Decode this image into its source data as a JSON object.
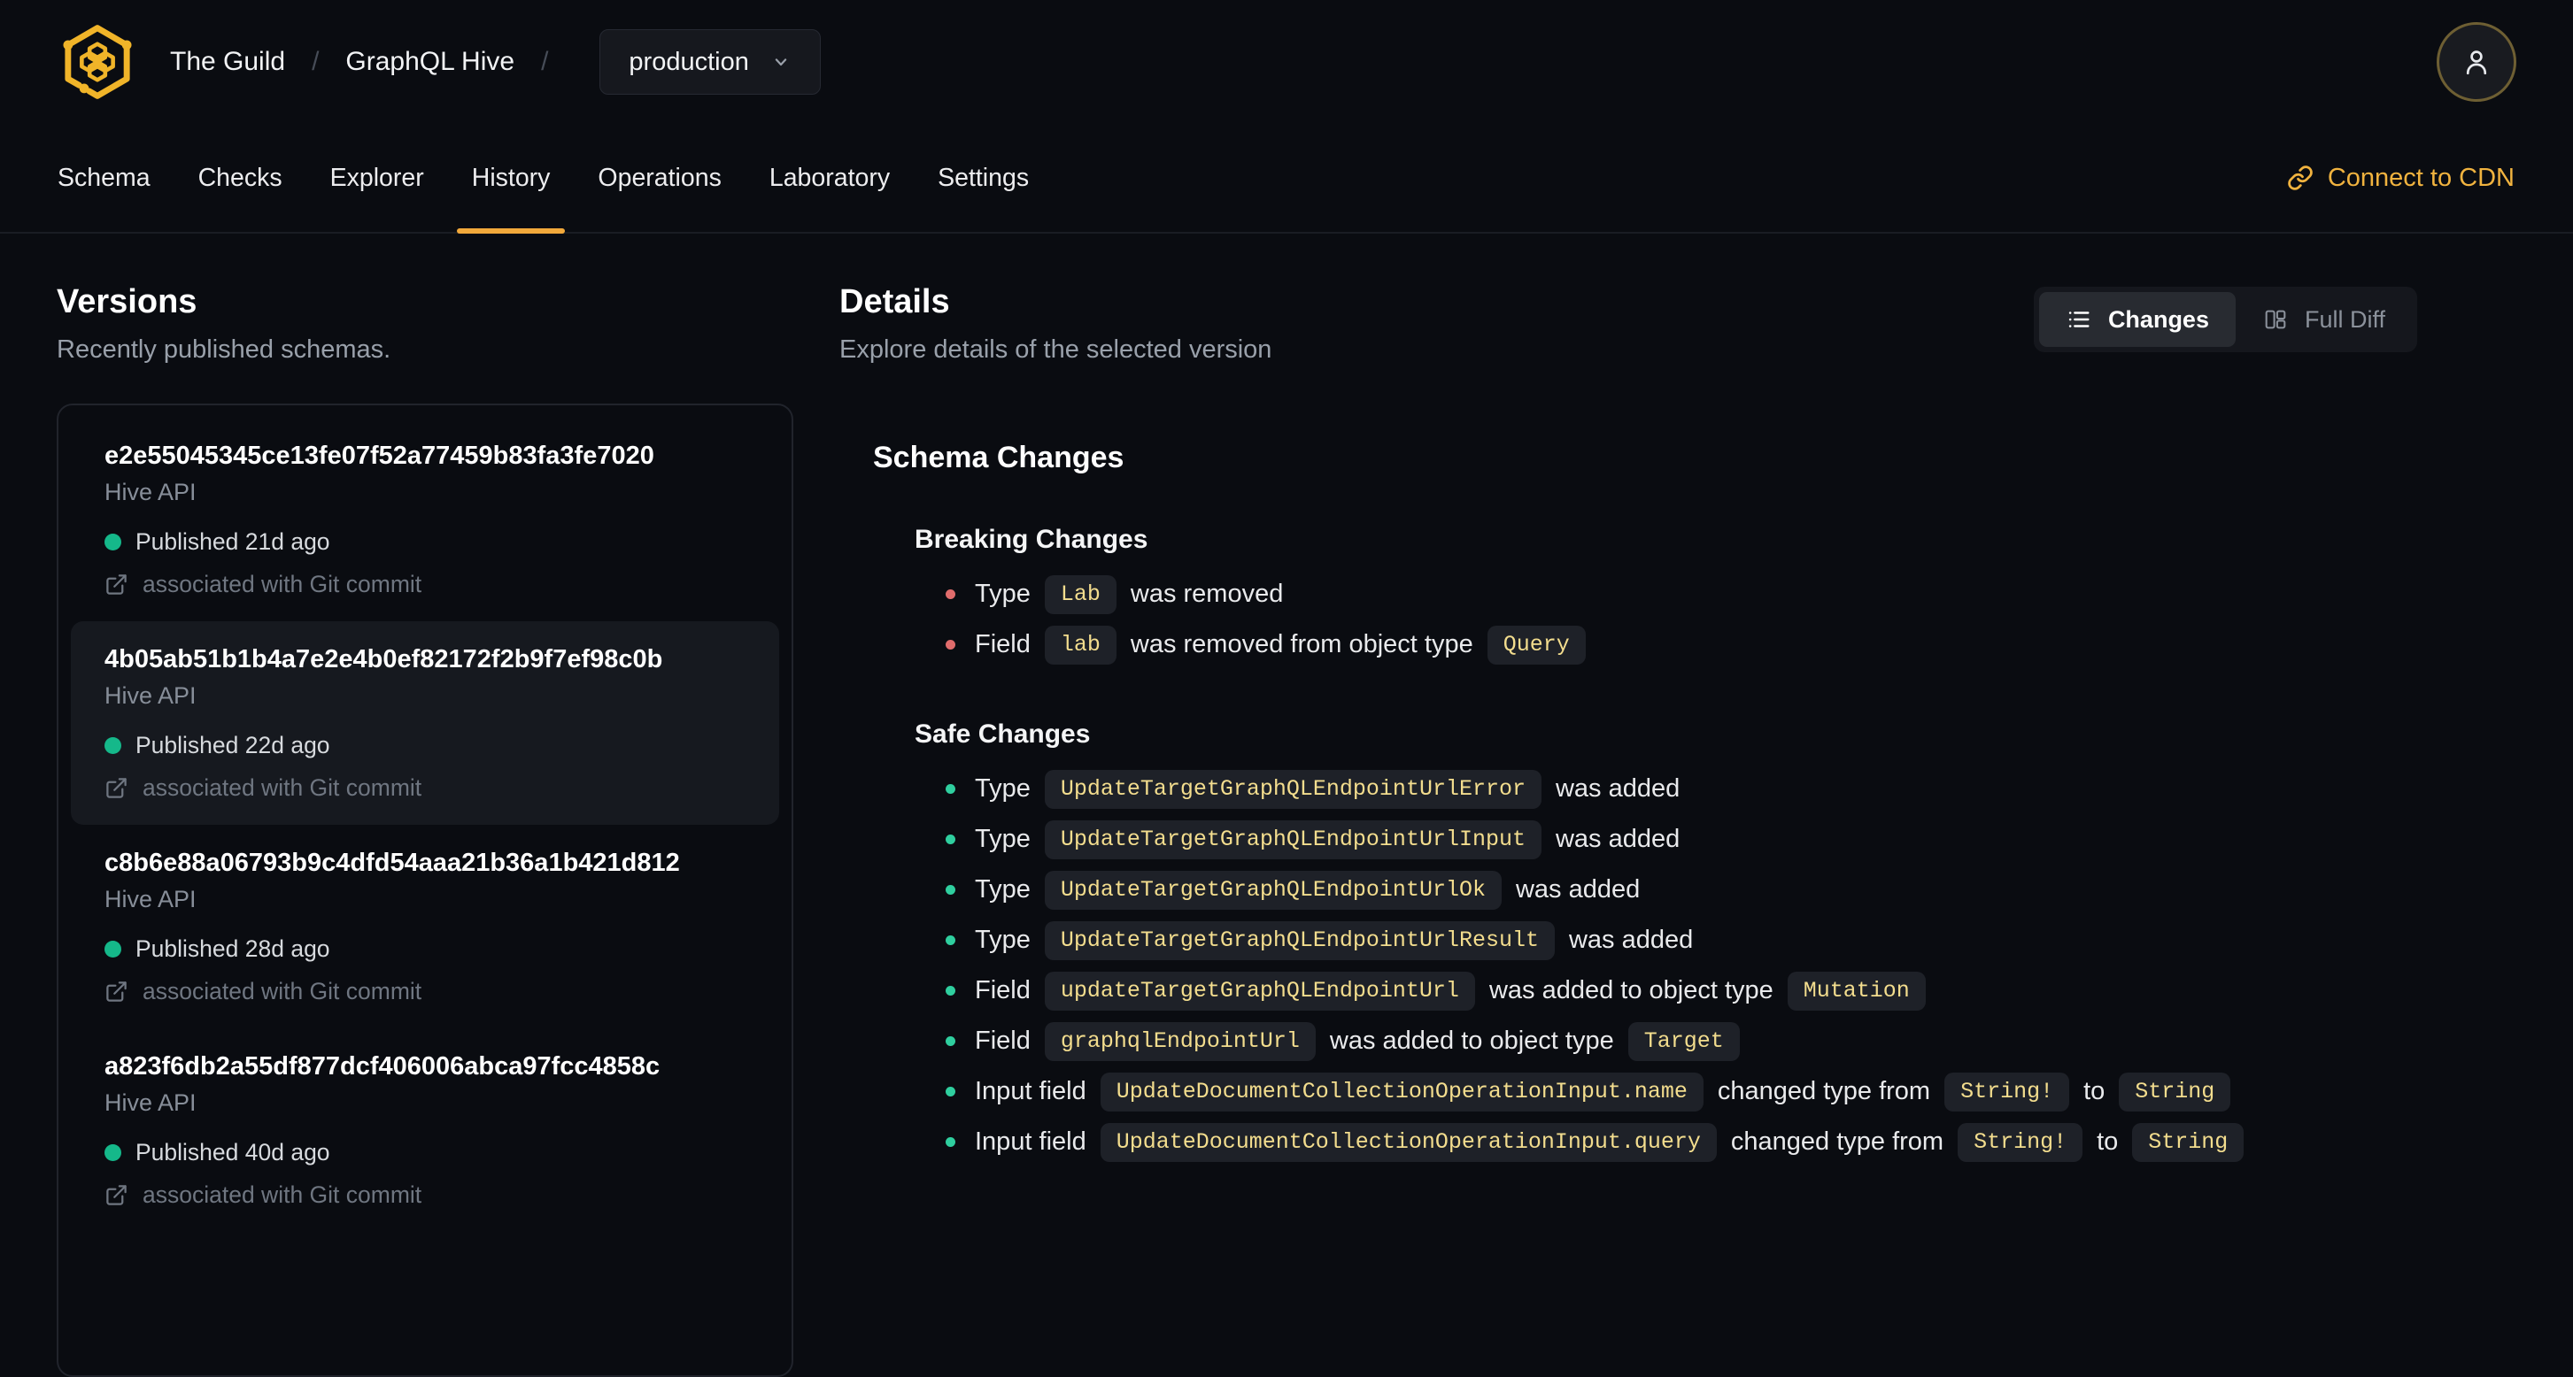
{
  "brand": {
    "org": "The Guild",
    "project": "GraphQL Hive",
    "environment": "production",
    "breadcrumb_separator": "/",
    "logo": "hive-honeycomb-icon"
  },
  "header": {
    "connect_cdn_label": "Connect to CDN",
    "avatar_icon": "user-icon"
  },
  "tabs": [
    {
      "label": "Schema",
      "active": false
    },
    {
      "label": "Checks",
      "active": false
    },
    {
      "label": "Explorer",
      "active": false
    },
    {
      "label": "History",
      "active": true
    },
    {
      "label": "Operations",
      "active": false
    },
    {
      "label": "Laboratory",
      "active": false
    },
    {
      "label": "Settings",
      "active": false
    }
  ],
  "versions": {
    "title": "Versions",
    "subtitle": "Recently published schemas.",
    "items": [
      {
        "hash": "e2e55045345ce13fe07f52a77459b83fa3fe7020",
        "service": "Hive API",
        "published": "Published 21d ago",
        "git": "associated with Git commit",
        "selected": false
      },
      {
        "hash": "4b05ab51b1b4a7e2e4b0ef82172f2b9f7ef98c0b",
        "service": "Hive API",
        "published": "Published 22d ago",
        "git": "associated with Git commit",
        "selected": true
      },
      {
        "hash": "c8b6e88a06793b9c4dfd54aaa21b36a1b421d812",
        "service": "Hive API",
        "published": "Published 28d ago",
        "git": "associated with Git commit",
        "selected": false
      },
      {
        "hash": "a823f6db2a55df877dcf406006abca97fcc4858c",
        "service": "Hive API",
        "published": "Published 40d ago",
        "git": "associated with Git commit",
        "selected": false
      }
    ]
  },
  "details": {
    "title": "Details",
    "subtitle": "Explore details of the selected version",
    "view_toggle": {
      "options": [
        {
          "label": "Changes",
          "icon": "list-icon",
          "active": true
        },
        {
          "label": "Full Diff",
          "icon": "columns-icon",
          "active": false
        }
      ]
    },
    "schema_changes": {
      "title": "Schema Changes",
      "groups": [
        {
          "title": "Breaking Changes",
          "severity": "breaking",
          "items": [
            [
              {
                "t": "text",
                "v": "Type"
              },
              {
                "t": "code",
                "v": "Lab"
              },
              {
                "t": "text",
                "v": "was removed"
              }
            ],
            [
              {
                "t": "text",
                "v": "Field"
              },
              {
                "t": "code",
                "v": "lab"
              },
              {
                "t": "text",
                "v": "was removed from object type"
              },
              {
                "t": "code",
                "v": "Query"
              }
            ]
          ]
        },
        {
          "title": "Safe Changes",
          "severity": "safe",
          "items": [
            [
              {
                "t": "text",
                "v": "Type"
              },
              {
                "t": "code",
                "v": "UpdateTargetGraphQLEndpointUrlError"
              },
              {
                "t": "text",
                "v": "was added"
              }
            ],
            [
              {
                "t": "text",
                "v": "Type"
              },
              {
                "t": "code",
                "v": "UpdateTargetGraphQLEndpointUrlInput"
              },
              {
                "t": "text",
                "v": "was added"
              }
            ],
            [
              {
                "t": "text",
                "v": "Type"
              },
              {
                "t": "code",
                "v": "UpdateTargetGraphQLEndpointUrlOk"
              },
              {
                "t": "text",
                "v": "was added"
              }
            ],
            [
              {
                "t": "text",
                "v": "Type"
              },
              {
                "t": "code",
                "v": "UpdateTargetGraphQLEndpointUrlResult"
              },
              {
                "t": "text",
                "v": "was added"
              }
            ],
            [
              {
                "t": "text",
                "v": "Field"
              },
              {
                "t": "code",
                "v": "updateTargetGraphQLEndpointUrl"
              },
              {
                "t": "text",
                "v": "was added to object type"
              },
              {
                "t": "code",
                "v": "Mutation"
              }
            ],
            [
              {
                "t": "text",
                "v": "Field"
              },
              {
                "t": "code",
                "v": "graphqlEndpointUrl"
              },
              {
                "t": "text",
                "v": "was added to object type"
              },
              {
                "t": "code",
                "v": "Target"
              }
            ],
            [
              {
                "t": "text",
                "v": "Input field"
              },
              {
                "t": "code",
                "v": "UpdateDocumentCollectionOperationInput.name"
              },
              {
                "t": "text",
                "v": "changed type from"
              },
              {
                "t": "code",
                "v": "String!"
              },
              {
                "t": "text",
                "v": "to"
              },
              {
                "t": "code",
                "v": "String"
              }
            ],
            [
              {
                "t": "text",
                "v": "Input field"
              },
              {
                "t": "code",
                "v": "UpdateDocumentCollectionOperationInput.query"
              },
              {
                "t": "text",
                "v": "changed type from"
              },
              {
                "t": "code",
                "v": "String!"
              },
              {
                "t": "text",
                "v": "to"
              },
              {
                "t": "code",
                "v": "String"
              }
            ]
          ]
        }
      ]
    }
  },
  "colors": {
    "background": "#0a0c11",
    "accent_amber": "#f1b33f",
    "tab_underline": "#f2a93b",
    "code_text": "#f3dd8e",
    "code_badge_bg": "#1e2128",
    "breaking_bullet": "#e06c6c",
    "safe_bullet": "#2fcf9f",
    "published_dot": "#15b88a",
    "selected_item_bg": "#16191f",
    "muted_text": "#99a0aa"
  }
}
